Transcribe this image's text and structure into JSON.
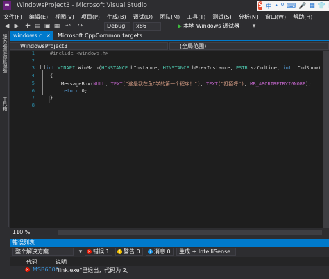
{
  "window": {
    "title": "WindowsProject3 - Microsoft Visual Studio"
  },
  "ime": {
    "logo": "S",
    "items": [
      "中",
      "•",
      "º",
      "⌨",
      "🎤",
      "▦",
      "👕",
      "▦"
    ]
  },
  "menu": [
    "文件(F)",
    "编辑(E)",
    "视图(V)",
    "项目(P)",
    "生成(B)",
    "调试(D)",
    "团队(M)",
    "工具(T)",
    "测试(S)",
    "分析(N)",
    "窗口(W)",
    "帮助(H)"
  ],
  "toolbar": {
    "config": "Debug",
    "platform": "x86",
    "run_label": "本地 Windows 调试器"
  },
  "side_tabs": [
    "服务器资源管理器",
    "工具箱"
  ],
  "tabs": [
    {
      "label": "windows.c"
    },
    {
      "label": "Microsoft.CppCommon.targets"
    }
  ],
  "nav": {
    "project": "WindowsProject3",
    "scope": "(全局范围)"
  },
  "editor": {
    "line_numbers": [
      "1",
      "2",
      "3",
      "4",
      "5",
      "6",
      "7",
      "8"
    ],
    "include": "#include <windows.h>",
    "line3": {
      "kw": "int",
      "ty1": "WINAPI",
      "fn": " WinMain(",
      "ty2": "HINSTANCE",
      "p1": " hInstance, ",
      "ty3": "HINSTANCE",
      "p2": " hPrevInstance, ",
      "ty4": "PSTR",
      "p3": " szCmdLine, ",
      "ty5": "int",
      "p4": " iCmdShow)"
    },
    "line4": "{",
    "line5": {
      "fn": "MessageBox(",
      "mac1": "NULL",
      "sep1": ", ",
      "mac2": "TEXT",
      "str1": "(\"这是我在鱼C学的第一个程序！\")",
      "sep2": ", ",
      "mac3": "TEXT",
      "str2": "(\"打招呼\")",
      "sep3": ", ",
      "mac4": "MB_ABORTRETRYIGNORE",
      "end": ");"
    },
    "line6": {
      "kw": "return",
      "rest": " 0;"
    },
    "line7": "}"
  },
  "zoom": "110 %",
  "error_list": {
    "title": "错误列表",
    "scope": "整个解决方案",
    "errors": "错误 1",
    "warnings": "警告 0",
    "messages": "消息 0",
    "build_filter": "生成 + IntelliSense",
    "col_code": "代码",
    "col_desc": "说明",
    "row": {
      "code": "MSB6006",
      "desc": "\"link.exe\"已退出，代码为 2。"
    }
  },
  "colors": {
    "accent": "#007acc",
    "error": "#e51400",
    "warning": "#f3c100",
    "info": "#1c97ea"
  }
}
